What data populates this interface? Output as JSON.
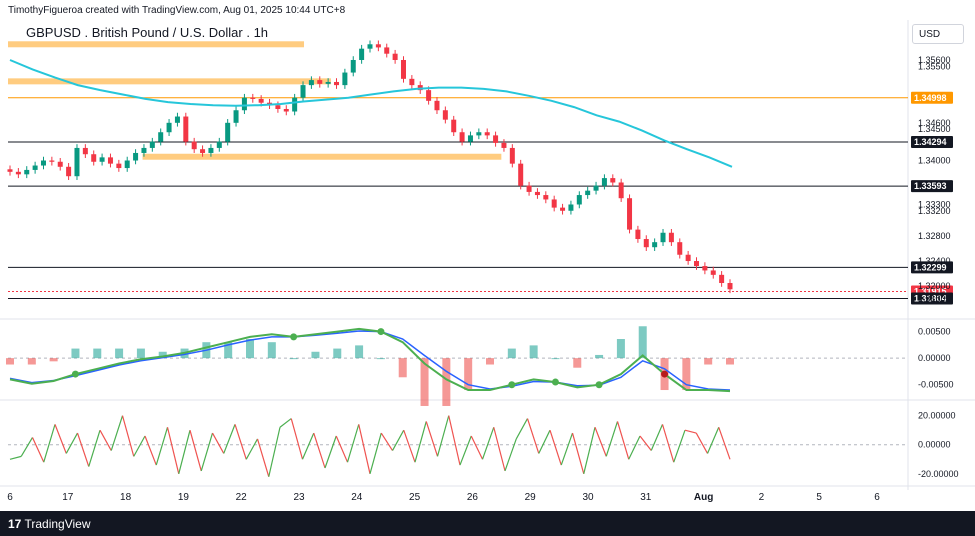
{
  "header": {
    "attribution": "TimothyFigueroa created with TradingView.com, Aug 01, 2025 10:44 UTC+8",
    "symbol_title": "GBPUSD . British Pound / U.S. Dollar . 1h",
    "currency": "USD"
  },
  "footer": {
    "brand_mark": "17",
    "brand": "TradingView"
  },
  "chart_data": {
    "type": "candlestick",
    "symbol": "GBPUSD",
    "interval": "1h",
    "x_ticks": [
      "6",
      "17",
      "18",
      "19",
      "22",
      "23",
      "24",
      "25",
      "26",
      "29",
      "30",
      "31",
      "Aug",
      "2",
      "5",
      "6"
    ],
    "price_axis": {
      "ticks": [
        1.356,
        1.355,
        1.346,
        1.345,
        1.34,
        1.333,
        1.332,
        1.328,
        1.324,
        1.32,
        1.318
      ],
      "tick_labels": [
        "1.35600",
        "1.35500",
        "1.34600",
        "1.34500",
        "1.34000",
        "1.33300",
        "1.33200",
        "1.32800",
        "1.32400",
        "1.32000",
        "1.31800"
      ],
      "ylim": [
        1.317,
        1.3595
      ]
    },
    "horizontal_levels": [
      {
        "value": 1.34998,
        "label": "1.34998",
        "color": "#ff9800"
      },
      {
        "value": 1.34294,
        "label": "1.34294",
        "color": "#131722"
      },
      {
        "value": 1.33593,
        "label": "1.33593",
        "color": "#131722"
      },
      {
        "value": 1.32299,
        "label": "1.32299",
        "color": "#131722"
      },
      {
        "value": 1.31915,
        "label": "1.31915",
        "color": "#f23645"
      },
      {
        "value": 1.31804,
        "label": "1.31804",
        "color": "#131722"
      }
    ],
    "zones": [
      {
        "from_x": 0.0,
        "to_x": 0.33,
        "value": 1.3585
      },
      {
        "from_x": 0.0,
        "to_x": 0.36,
        "value": 1.3526
      },
      {
        "from_x": 0.15,
        "to_x": 0.55,
        "value": 1.3406
      }
    ],
    "close_series": [
      1.3382,
      1.3378,
      1.3385,
      1.3392,
      1.34,
      1.3398,
      1.339,
      1.3375,
      1.342,
      1.341,
      1.3398,
      1.3405,
      1.3395,
      1.3388,
      1.34,
      1.3412,
      1.342,
      1.343,
      1.3445,
      1.346,
      1.347,
      1.343,
      1.3418,
      1.3412,
      1.342,
      1.343,
      1.346,
      1.348,
      1.35,
      1.3498,
      1.3492,
      1.3488,
      1.3482,
      1.3478,
      1.35,
      1.352,
      1.3528,
      1.3522,
      1.3525,
      1.352,
      1.354,
      1.356,
      1.3578,
      1.3585,
      1.358,
      1.357,
      1.356,
      1.353,
      1.352,
      1.3512,
      1.3495,
      1.348,
      1.3465,
      1.3445,
      1.343,
      1.344,
      1.3445,
      1.344,
      1.3428,
      1.342,
      1.3395,
      1.336,
      1.335,
      1.3345,
      1.3338,
      1.3325,
      1.332,
      1.333,
      1.3345,
      1.3352,
      1.336,
      1.3372,
      1.3365,
      1.334,
      1.329,
      1.3275,
      1.3262,
      1.327,
      1.3285,
      1.327,
      1.325,
      1.324,
      1.3232,
      1.3225,
      1.3218,
      1.3205,
      1.3195
    ],
    "moving_average": [
      1.356,
      1.3545,
      1.3532,
      1.352,
      1.3512,
      1.3505,
      1.3498,
      1.3493,
      1.349,
      1.3488,
      1.3487,
      1.3488,
      1.349,
      1.3494,
      1.3497,
      1.35,
      1.3505,
      1.351,
      1.3514,
      1.3516,
      1.3516,
      1.3514,
      1.351,
      1.3503,
      1.3495,
      1.3485,
      1.3472,
      1.3462,
      1.3448,
      1.3432,
      1.3418,
      1.3405,
      1.339
    ],
    "macd_panel": {
      "ticks": [
        0.005,
        0.0,
        -0.005
      ],
      "tick_labels": [
        "0.00500",
        "0.00000",
        "-0.00500"
      ],
      "ylim": [
        -0.0075,
        0.0068
      ],
      "macd": [
        -0.004,
        -0.0048,
        -0.0043,
        -0.003,
        -0.002,
        -0.001,
        -0.0002,
        0.0003,
        0.001,
        0.002,
        0.003,
        0.004,
        0.0045,
        0.004,
        0.0045,
        0.005,
        0.0055,
        0.005,
        0.003,
        -0.001,
        -0.004,
        -0.006,
        -0.006,
        -0.005,
        -0.004,
        -0.0045,
        -0.0055,
        -0.005,
        -0.003,
        0.0005,
        -0.003,
        -0.006,
        -0.006,
        -0.0062
      ],
      "signal": [
        -0.0038,
        -0.0046,
        -0.0042,
        -0.0033,
        -0.0023,
        -0.0013,
        -0.0005,
        0.0001,
        0.0007,
        0.0015,
        0.0025,
        0.0034,
        0.004,
        0.004,
        0.0043,
        0.0047,
        0.0051,
        0.005,
        0.0036,
        0.0005,
        -0.0025,
        -0.005,
        -0.0058,
        -0.0053,
        -0.0044,
        -0.0045,
        -0.0052,
        -0.0051,
        -0.0036,
        -0.0005,
        -0.002,
        -0.005,
        -0.0058,
        -0.006
      ]
    },
    "oscillator_panel": {
      "ticks": [
        20,
        0,
        -20
      ],
      "tick_labels": [
        "20.00000",
        "0.00000",
        "-20.00000"
      ],
      "ylim": [
        -27,
        28
      ],
      "values": [
        -10,
        -8,
        5,
        -12,
        14,
        -6,
        8,
        -15,
        10,
        -4,
        20,
        -8,
        6,
        -14,
        12,
        -20,
        10,
        -18,
        8,
        -6,
        14,
        -10,
        4,
        -22,
        12,
        18,
        -10,
        8,
        -16,
        6,
        -12,
        14,
        -20,
        8,
        -4,
        10,
        -12,
        16,
        -8,
        20,
        -14,
        6,
        -10,
        12,
        -18,
        4,
        18,
        -6,
        10,
        -14,
        8,
        -20,
        12,
        -8,
        16,
        -10,
        6,
        -4,
        14,
        -12,
        10,
        8,
        -6,
        12,
        -10
      ]
    }
  }
}
